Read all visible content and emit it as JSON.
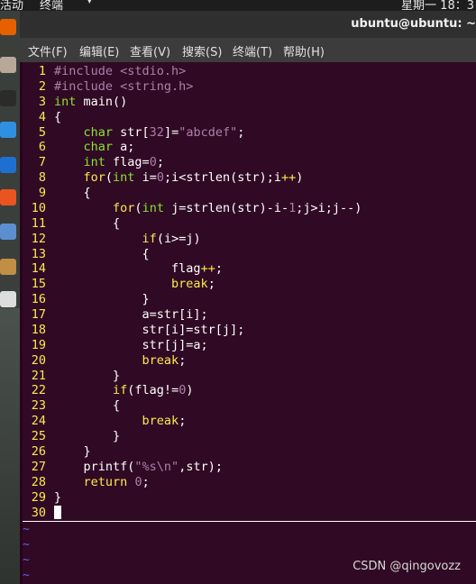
{
  "topbar": {
    "activities": "活动",
    "app_menu": "终端",
    "app_menu_arrow": "▾",
    "clock": "星期一 18：3"
  },
  "window": {
    "title": "ubuntu@ubuntu: ~"
  },
  "menu": [
    "文件(F)",
    "编辑(E)",
    "查看(V)",
    "搜索(S)",
    "终端(T)",
    "帮助(H)"
  ],
  "dock": [
    {
      "name": "firefox-icon",
      "color": "#e66000"
    },
    {
      "name": "files-icon",
      "color": "#b7a89a"
    },
    {
      "name": "terminal-icon",
      "color": "#2b2b2b"
    },
    {
      "name": "vscode-icon",
      "color": "#2f8fe0"
    },
    {
      "name": "devtool-icon",
      "color": "#1f6fd0"
    },
    {
      "name": "software-icon",
      "color": "#e95420"
    },
    {
      "name": "settings-icon",
      "color": "#5c8fd0"
    },
    {
      "name": "text-editor-icon",
      "color": "#c08e45"
    },
    {
      "name": "help-icon",
      "color": "#dddddd"
    }
  ],
  "code_lines": [
    [
      [
        "#include ",
        "pp"
      ],
      [
        "<stdio.h>",
        "st"
      ]
    ],
    [
      [
        "#include ",
        "pp"
      ],
      [
        "<string.h>",
        "st"
      ]
    ],
    [
      [
        "int",
        "ty"
      ],
      [
        " main()",
        "tx"
      ]
    ],
    [
      [
        "{",
        "tx"
      ]
    ],
    [
      [
        "    ",
        "tx"
      ],
      [
        "char",
        "ty"
      ],
      [
        " str[",
        "tx"
      ],
      [
        "32",
        "nm"
      ],
      [
        "]=",
        "tx"
      ],
      [
        "\"abcdef\"",
        "st"
      ],
      [
        ";",
        "tx"
      ]
    ],
    [
      [
        "    ",
        "tx"
      ],
      [
        "char",
        "ty"
      ],
      [
        " a;",
        "tx"
      ]
    ],
    [
      [
        "    ",
        "tx"
      ],
      [
        "int",
        "ty"
      ],
      [
        " flag=",
        "tx"
      ],
      [
        "0",
        "nm"
      ],
      [
        ";",
        "tx"
      ]
    ],
    [
      [
        "    ",
        "tx"
      ],
      [
        "for",
        "kw"
      ],
      [
        "(",
        "tx"
      ],
      [
        "int",
        "ty"
      ],
      [
        " i=",
        "tx"
      ],
      [
        "0",
        "nm"
      ],
      [
        ";i<strlen(str);i",
        "tx"
      ],
      [
        "++",
        "op"
      ],
      [
        ")",
        "tx"
      ]
    ],
    [
      [
        "    {",
        "tx"
      ]
    ],
    [
      [
        "        ",
        "tx"
      ],
      [
        "for",
        "kw"
      ],
      [
        "(",
        "tx"
      ],
      [
        "int",
        "ty"
      ],
      [
        " j=strlen(str)-i-",
        "tx"
      ],
      [
        "1",
        "nm"
      ],
      [
        ";j>i;j--)",
        "tx"
      ]
    ],
    [
      [
        "        {",
        "tx"
      ]
    ],
    [
      [
        "            ",
        "tx"
      ],
      [
        "if",
        "kw"
      ],
      [
        "(i>=j)",
        "tx"
      ]
    ],
    [
      [
        "            {",
        "tx"
      ]
    ],
    [
      [
        "                flag",
        "tx"
      ],
      [
        "++",
        "op"
      ],
      [
        ";",
        "tx"
      ]
    ],
    [
      [
        "                ",
        "tx"
      ],
      [
        "break",
        "kw"
      ],
      [
        ";",
        "tx"
      ]
    ],
    [
      [
        "            }",
        "tx"
      ]
    ],
    [
      [
        "            a=str[i];",
        "tx"
      ]
    ],
    [
      [
        "            str[i]=str[j];",
        "tx"
      ]
    ],
    [
      [
        "            str[j]=a;",
        "tx"
      ]
    ],
    [
      [
        "            ",
        "tx"
      ],
      [
        "break",
        "kw"
      ],
      [
        ";",
        "tx"
      ]
    ],
    [
      [
        "        }",
        "tx"
      ]
    ],
    [
      [
        "        ",
        "tx"
      ],
      [
        "if",
        "kw"
      ],
      [
        "(flag!=",
        "tx"
      ],
      [
        "0",
        "nm"
      ],
      [
        ")",
        "tx"
      ]
    ],
    [
      [
        "        {",
        "tx"
      ]
    ],
    [
      [
        "            ",
        "tx"
      ],
      [
        "break",
        "kw"
      ],
      [
        ";",
        "tx"
      ]
    ],
    [
      [
        "        }",
        "tx"
      ]
    ],
    [
      [
        "    }",
        "tx"
      ]
    ],
    [
      [
        "    printf(",
        "tx"
      ],
      [
        "\"%s\\n\"",
        "st"
      ],
      [
        ",str);",
        "tx"
      ]
    ],
    [
      [
        "    ",
        "tx"
      ],
      [
        "return",
        "kw"
      ],
      [
        " ",
        "tx"
      ],
      [
        "0",
        "nm"
      ],
      [
        ";",
        "tx"
      ]
    ],
    [
      [
        "}",
        "tx"
      ]
    ],
    []
  ],
  "line_numbers": [
    "1",
    "2",
    "3",
    "4",
    "5",
    "6",
    "7",
    "8",
    "9",
    "10",
    "11",
    "12",
    "13",
    "14",
    "15",
    "16",
    "17",
    "18",
    "19",
    "20",
    "21",
    "22",
    "23",
    "24",
    "25",
    "26",
    "27",
    "28",
    "29",
    "30"
  ],
  "tildes": [
    "~",
    "~",
    "~",
    "~"
  ],
  "watermark": "CSDN @qingovozz"
}
